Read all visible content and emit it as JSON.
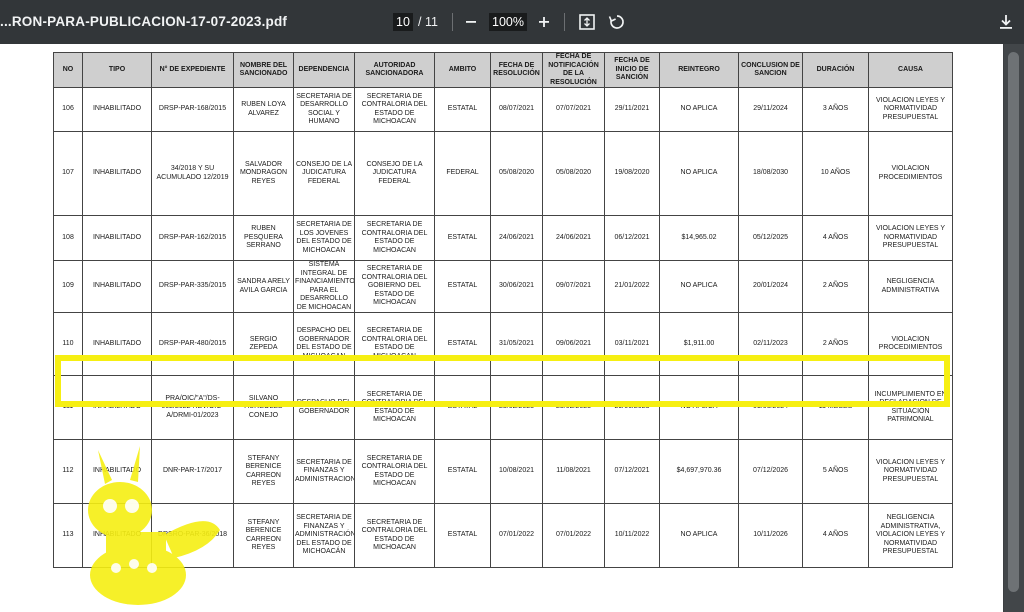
{
  "toolbar": {
    "file_title": "...RON-PARA-PUBLICACION-17-07-2023.pdf",
    "current_page": "10",
    "page_separator": "/",
    "total_pages": "11",
    "zoom": "100%"
  },
  "table": {
    "headers": [
      "NO",
      "TIPO",
      "N° DE EXPEDIENTE",
      "NOMBRE DEL SANCIONADO",
      "DEPENDENCIA",
      "AUTORIDAD SANCIONADORA",
      "AMBITO",
      "FECHA DE RESOLUCIÓN",
      "FECHA DE NOTIFICACIÓN DE LA RESOLUCIÓN",
      "FECHA DE INICIO DE SANCIÓN",
      "REINTEGRO",
      "CONCLUSION DE SANCION",
      "DURACIÓN",
      "CAUSA"
    ],
    "rows": [
      [
        "106",
        "INHABILITADO",
        "DRSP-PAR-168/2015",
        "RUBEN LOYA ALVAREZ",
        "SECRETARIA DE DESARROLLO SOCIAL Y HUMANO",
        "SECRETARIA DE CONTRALORIA DEL ESTADO DE MICHOACAN",
        "ESTATAL",
        "08/07/2021",
        "07/07/2021",
        "29/11/2021",
        "NO APLICA",
        "29/11/2024",
        "3 AÑOS",
        "VIOLACION LEYES Y NORMATIVIDAD PRESUPUESTAL"
      ],
      [
        "107",
        "INHABILITADO",
        "34/2018 Y SU ACUMULADO 12/2019",
        "SALVADOR MONDRAGON REYES",
        "CONSEJO DE LA JUDICATURA FEDERAL",
        "CONSEJO DE LA JUDICATURA FEDERAL",
        "FEDERAL",
        "05/08/2020",
        "05/08/2020",
        "19/08/2020",
        "NO APLICA",
        "18/08/2030",
        "10 AÑOS",
        "VIOLACION PROCEDIMIENTOS"
      ],
      [
        "108",
        "INHABILITADO",
        "DRSP-PAR-162/2015",
        "RUBEN PESQUERA SERRANO",
        "SECRETARIA DE LOS JOVENES DEL ESTADO DE MICHOACAN",
        "SECRETARIA DE CONTRALORIA DEL ESTADO DE MICHOACAN",
        "ESTATAL",
        "24/06/2021",
        "24/06/2021",
        "06/12/2021",
        "$14,965.02",
        "05/12/2025",
        "4 AÑOS",
        "VIOLACION LEYES Y NORMATIVIDAD PRESUPUESTAL"
      ],
      [
        "109",
        "INHABILITADO",
        "DRSP-PAR-335/2015",
        "SANDRA ARELY AVILA GARCIA",
        "SISTEMA INTEGRAL DE FINANCIAMIENTO PARA EL DESARROLLO DE MICHOACAN",
        "SECRETARIA DE CONTRALORIA DEL GOBIERNO DEL ESTADO DE MICHOACAN",
        "ESTATAL",
        "30/06/2021",
        "09/07/2021",
        "21/01/2022",
        "NO APLICA",
        "20/01/2024",
        "2 AÑOS",
        "NEGLIGENCIA ADMINISTRATIVA"
      ],
      [
        "110",
        "INHABILITADO",
        "DRSP-PAR-480/2015",
        "SERGIO ZEPEDA",
        "DESPACHO DEL GOBERNADOR DEL ESTADO DE MICHOACAN",
        "SECRETARIA DE CONTRALORIA DEL ESTADO DE MICHOACAN",
        "ESTATAL",
        "31/05/2021",
        "09/06/2021",
        "03/11/2021",
        "$1,911.00",
        "02/11/2023",
        "2 AÑOS",
        "VIOLACION PROCEDIMIENTOS"
      ],
      [
        "111",
        "INHABILITADO",
        "PRA/OIC/\"A\"/DS-002/2022 REV/OIC-A/DRMI-01/2023",
        "SILVANO AUREOLES CONEJO",
        "DESPACHO DEL GOBERNADOR",
        "SECRETARIA DE CONTRALORIA DEL ESTADO DE MICHOACAN",
        "ESTATAL",
        "23/02/2023",
        "23/02/2023",
        "29/06/2023",
        "NO APLICA",
        "01/06/2024",
        "11 MESES",
        "INCUMPLIMIENTO EN DECLARACION DE SITUACIÓN PATRIMONIAL"
      ],
      [
        "112",
        "INHABILITADO",
        "DNR-PAR-17/2017",
        "STEFANY BERENICE CARREON REYES",
        "SECRETARIA DE FINANZAS Y ADMINISTRACION",
        "SECRETARIA DE CONTRALORIA DEL ESTADO DE MICHOACAN",
        "ESTATAL",
        "10/08/2021",
        "11/08/2021",
        "07/12/2021",
        "$4,697,970.36",
        "07/12/2026",
        "5 AÑOS",
        "VIOLACION LEYES Y NORMATIVIDAD PRESUPUESTAL"
      ],
      [
        "113",
        "INHABILITADO",
        "DRSRO-PAR-36/2018",
        "STEFANY BERENICE CARREON REYES",
        "SECRETARIA DE FINANZAS Y ADMINISTRACIÓN DEL ESTADO DE MICHOACÁN",
        "SECRETARIA DE CONTRALORIA DEL ESTADO DE MICHOACAN",
        "ESTATAL",
        "07/01/2022",
        "07/01/2022",
        "10/11/2022",
        "NO APLICA",
        "10/11/2026",
        "4 AÑOS",
        "NEGLIGENCIA ADMINISTRATIVA, VIOLACION LEYES Y NORMATIVIDAD PRESUPUESTAL"
      ]
    ]
  },
  "colors": {
    "toolbar_bg": "#323639",
    "viewer_bg": "#525659",
    "highlight": "#f6ef12",
    "header_bg": "#cfcfcf"
  },
  "icons": [
    "zoom-out-icon",
    "zoom-in-icon",
    "fit-page-icon",
    "rotate-icon",
    "download-icon"
  ]
}
